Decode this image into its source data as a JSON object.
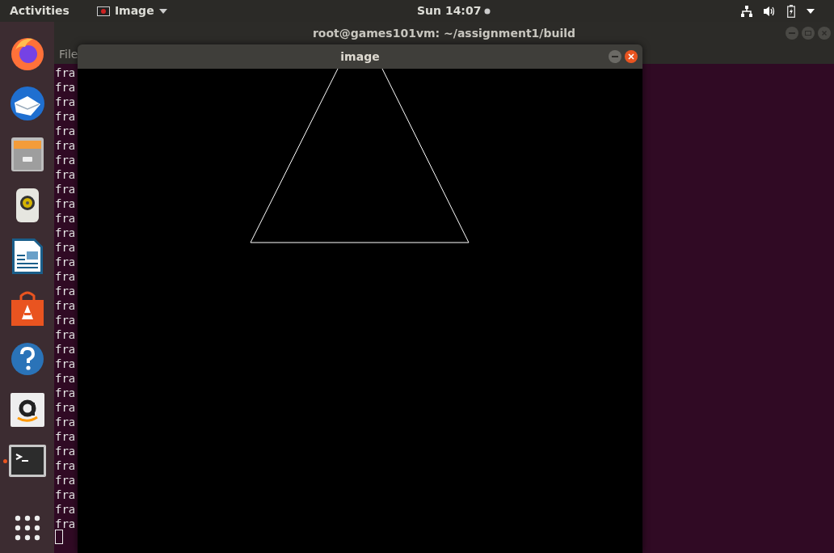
{
  "top_bar": {
    "activities": "Activities",
    "app_menu": "Image",
    "clock": "Sun 14:07"
  },
  "dock": [
    {
      "kind": "firefox",
      "running": false
    },
    {
      "kind": "thunderbird",
      "running": false
    },
    {
      "kind": "files",
      "running": false
    },
    {
      "kind": "rhythmbox",
      "running": false
    },
    {
      "kind": "writer",
      "running": false
    },
    {
      "kind": "software",
      "running": false
    },
    {
      "kind": "help",
      "running": false
    },
    {
      "kind": "amazon",
      "running": false
    },
    {
      "kind": "terminal",
      "running": true
    },
    {
      "kind": "apps",
      "running": false
    }
  ],
  "terminal": {
    "title": "root@games101vm: ~/assignment1/build",
    "menu": [
      "File"
    ],
    "lines": [
      "fra",
      "fra",
      "fra",
      "fra",
      "fra",
      "fra",
      "fra",
      "fra",
      "fra",
      "fra",
      "fra",
      "fra",
      "fra",
      "fra",
      "fra",
      "fra",
      "fra",
      "fra",
      "fra",
      "fra",
      "fra",
      "fra",
      "fra",
      "fra",
      "fra",
      "fra",
      "fra",
      "fra",
      "fra",
      "fra",
      "fra",
      "fra"
    ]
  },
  "image_window": {
    "title": "image"
  }
}
